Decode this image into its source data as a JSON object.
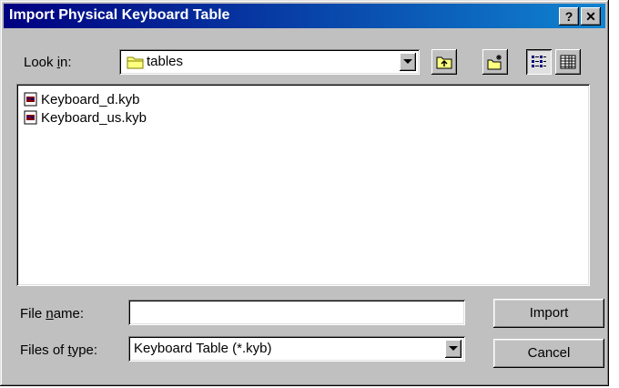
{
  "window": {
    "title": "Import Physical Keyboard Table",
    "help_label": "?",
    "close_label": "✕"
  },
  "lookin": {
    "label_pre": "Look ",
    "label_key": "i",
    "label_post": "n:",
    "value": "tables"
  },
  "toolbar": {
    "icons": [
      "up-one-level-icon",
      "create-new-folder-icon",
      "list-view-icon",
      "details-view-icon"
    ]
  },
  "files": [
    {
      "name": "Keyboard_d.kyb",
      "icon": "keyboard-table-file-icon"
    },
    {
      "name": "Keyboard_us.kyb",
      "icon": "keyboard-table-file-icon"
    }
  ],
  "filename": {
    "label_pre": "File ",
    "label_key": "n",
    "label_post": "ame:",
    "value": ""
  },
  "filetype": {
    "label_pre": "Files of ",
    "label_key": "t",
    "label_post": "ype:",
    "value": "Keyboard Table (*.kyb)"
  },
  "buttons": {
    "import": "Import",
    "cancel": "Cancel"
  },
  "colors": {
    "title_start": "#000080",
    "title_end": "#1084d0",
    "face": "#c0c0c0"
  }
}
